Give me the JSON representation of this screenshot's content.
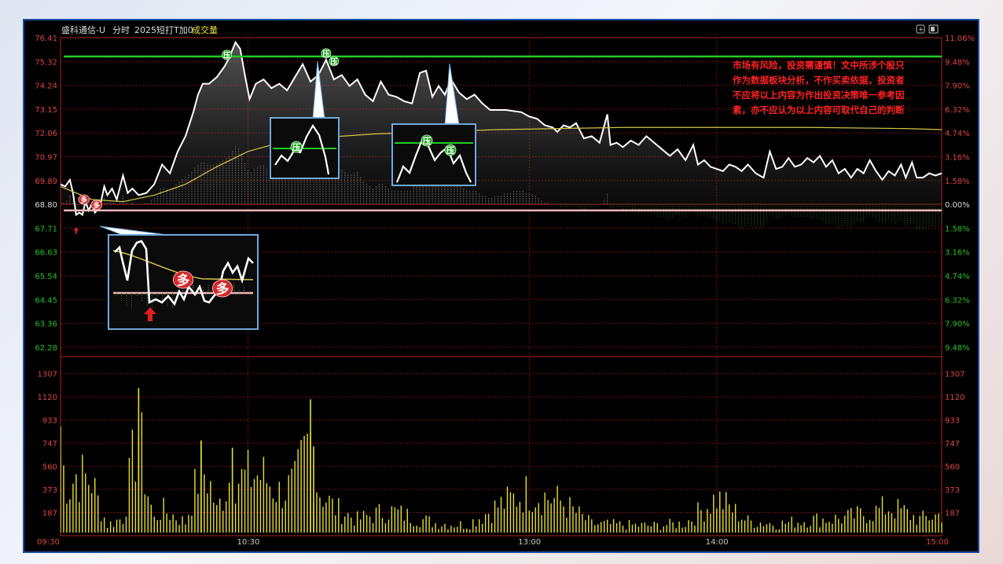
{
  "header": {
    "stock_name": "盛科通信-U",
    "view": "分时",
    "indicator": "2025短打T加0",
    "volume_label": "成交量"
  },
  "warning": [
    "市场有风险，投资需谨慎！文中所涉个股只",
    "作为数据板块分析，不作买卖依据，投资者",
    "不应将以上内容为作出投资决策唯一参考因",
    "素，亦不应认为以上内容可取代自己的判断"
  ],
  "signals": {
    "buy_char": "多",
    "resist_char": "压"
  },
  "colors": {
    "price_line": "#ffffff",
    "avg_line": "#d4c84a",
    "resistance": "#22cc22",
    "support": "#f0b6b6",
    "up_text": "#e04444",
    "down_text": "#28c028",
    "volume_bar": "#e8e030",
    "grid": "#7a0e0e",
    "border": "#1d4fa8"
  },
  "chart_data": {
    "type": "line",
    "price_axis": {
      "ticks": [
        "76.41",
        "75.32",
        "74.24",
        "73.15",
        "72.06",
        "70.97",
        "69.89",
        "68.80",
        "67.71",
        "66.63",
        "65.54",
        "64.45",
        "63.36",
        "62.28"
      ],
      "pct_ticks": [
        "11.06%",
        "9.48%",
        "7.90%",
        "6.32%",
        "4.74%",
        "3.16%",
        "1.58%",
        "0.00%",
        "1.58%",
        "3.16%",
        "4.74%",
        "6.32%",
        "7.90%",
        "9.48%"
      ],
      "reference_price": 68.8,
      "ylim": [
        62.28,
        76.41
      ]
    },
    "volume_axis": {
      "ticks": [
        "1307",
        "1120",
        "933",
        "747",
        "560",
        "373",
        "187"
      ],
      "ylim": [
        0,
        1400
      ]
    },
    "time_labels": [
      "09:30",
      "10:30",
      "13:00",
      "14:00",
      "15:00"
    ],
    "resistance_level": 75.55,
    "support_level": 68.5,
    "price_series": [
      {
        "t": 0,
        "v": 69.7
      },
      {
        "t": 3,
        "v": 69.6
      },
      {
        "t": 6,
        "v": 69.9
      },
      {
        "t": 8,
        "v": 69.3
      },
      {
        "t": 10,
        "v": 68.3
      },
      {
        "t": 12,
        "v": 68.4
      },
      {
        "t": 14,
        "v": 68.3
      },
      {
        "t": 16,
        "v": 68.9
      },
      {
        "t": 18,
        "v": 68.5
      },
      {
        "t": 20,
        "v": 68.8
      },
      {
        "t": 22,
        "v": 68.4
      },
      {
        "t": 25,
        "v": 68.6
      },
      {
        "t": 28,
        "v": 69.6
      },
      {
        "t": 30,
        "v": 69.2
      },
      {
        "t": 33,
        "v": 69.5
      },
      {
        "t": 36,
        "v": 69.0
      },
      {
        "t": 40,
        "v": 70.1
      },
      {
        "t": 43,
        "v": 69.3
      },
      {
        "t": 46,
        "v": 69.5
      },
      {
        "t": 50,
        "v": 69.2
      },
      {
        "t": 55,
        "v": 69.3
      },
      {
        "t": 60,
        "v": 69.7
      },
      {
        "t": 65,
        "v": 70.6
      },
      {
        "t": 70,
        "v": 70.2
      },
      {
        "t": 75,
        "v": 71.2
      },
      {
        "t": 80,
        "v": 71.9
      },
      {
        "t": 85,
        "v": 73.0
      },
      {
        "t": 88,
        "v": 73.8
      },
      {
        "t": 91,
        "v": 74.3
      },
      {
        "t": 95,
        "v": 74.3
      },
      {
        "t": 100,
        "v": 74.6
      },
      {
        "t": 105,
        "v": 75.1
      },
      {
        "t": 108,
        "v": 75.5
      },
      {
        "t": 112,
        "v": 76.2
      },
      {
        "t": 115,
        "v": 75.9
      },
      {
        "t": 118,
        "v": 74.7
      },
      {
        "t": 121,
        "v": 73.6
      },
      {
        "t": 125,
        "v": 74.3
      },
      {
        "t": 130,
        "v": 74.5
      },
      {
        "t": 135,
        "v": 74.1
      },
      {
        "t": 140,
        "v": 74.3
      },
      {
        "t": 145,
        "v": 74.0
      },
      {
        "t": 150,
        "v": 74.6
      },
      {
        "t": 155,
        "v": 75.2
      },
      {
        "t": 160,
        "v": 74.4
      },
      {
        "t": 165,
        "v": 74.7
      },
      {
        "t": 170,
        "v": 75.4
      },
      {
        "t": 175,
        "v": 74.5
      },
      {
        "t": 180,
        "v": 74.7
      },
      {
        "t": 185,
        "v": 74.2
      },
      {
        "t": 190,
        "v": 74.5
      },
      {
        "t": 195,
        "v": 73.8
      },
      {
        "t": 200,
        "v": 73.5
      },
      {
        "t": 205,
        "v": 74.4
      },
      {
        "t": 210,
        "v": 73.8
      },
      {
        "t": 215,
        "v": 73.7
      },
      {
        "t": 220,
        "v": 73.5
      },
      {
        "t": 225,
        "v": 73.4
      },
      {
        "t": 230,
        "v": 74.8
      },
      {
        "t": 234,
        "v": 74.9
      },
      {
        "t": 238,
        "v": 73.7
      },
      {
        "t": 242,
        "v": 74.2
      },
      {
        "t": 246,
        "v": 73.8
      },
      {
        "t": 250,
        "v": 74.5
      },
      {
        "t": 255,
        "v": 73.9
      },
      {
        "t": 260,
        "v": 73.6
      },
      {
        "t": 265,
        "v": 73.8
      },
      {
        "t": 270,
        "v": 73.4
      },
      {
        "t": 275,
        "v": 73.1
      },
      {
        "t": 285,
        "v": 73.1
      },
      {
        "t": 295,
        "v": 73.0
      },
      {
        "t": 300,
        "v": 72.8
      },
      {
        "t": 305,
        "v": 72.7
      },
      {
        "t": 310,
        "v": 72.4
      },
      {
        "t": 315,
        "v": 72.3
      },
      {
        "t": 318,
        "v": 72.1
      },
      {
        "t": 322,
        "v": 72.4
      },
      {
        "t": 326,
        "v": 72.3
      },
      {
        "t": 330,
        "v": 72.5
      },
      {
        "t": 335,
        "v": 71.8
      },
      {
        "t": 340,
        "v": 71.9
      },
      {
        "t": 345,
        "v": 71.6
      },
      {
        "t": 350,
        "v": 72.9
      },
      {
        "t": 352,
        "v": 71.5
      },
      {
        "t": 356,
        "v": 71.6
      },
      {
        "t": 360,
        "v": 71.4
      },
      {
        "t": 365,
        "v": 71.7
      },
      {
        "t": 370,
        "v": 71.5
      },
      {
        "t": 375,
        "v": 71.9
      },
      {
        "t": 380,
        "v": 71.6
      },
      {
        "t": 385,
        "v": 71.3
      },
      {
        "t": 390,
        "v": 71.0
      },
      {
        "t": 395,
        "v": 71.3
      },
      {
        "t": 400,
        "v": 70.8
      },
      {
        "t": 405,
        "v": 71.5
      },
      {
        "t": 408,
        "v": 70.6
      },
      {
        "t": 412,
        "v": 70.8
      },
      {
        "t": 416,
        "v": 70.5
      },
      {
        "t": 420,
        "v": 70.4
      },
      {
        "t": 424,
        "v": 70.3
      },
      {
        "t": 428,
        "v": 70.6
      },
      {
        "t": 432,
        "v": 70.5
      },
      {
        "t": 436,
        "v": 70.3
      },
      {
        "t": 440,
        "v": 70.6
      },
      {
        "t": 445,
        "v": 70.2
      },
      {
        "t": 450,
        "v": 70.0
      },
      {
        "t": 454,
        "v": 71.2
      },
      {
        "t": 458,
        "v": 70.4
      },
      {
        "t": 462,
        "v": 70.5
      },
      {
        "t": 466,
        "v": 70.9
      },
      {
        "t": 470,
        "v": 70.5
      },
      {
        "t": 474,
        "v": 70.6
      },
      {
        "t": 478,
        "v": 70.9
      },
      {
        "t": 482,
        "v": 70.7
      },
      {
        "t": 486,
        "v": 71.0
      },
      {
        "t": 490,
        "v": 70.5
      },
      {
        "t": 494,
        "v": 70.8
      },
      {
        "t": 498,
        "v": 70.2
      },
      {
        "t": 502,
        "v": 70.4
      },
      {
        "t": 506,
        "v": 70.0
      },
      {
        "t": 510,
        "v": 70.4
      },
      {
        "t": 514,
        "v": 70.2
      },
      {
        "t": 518,
        "v": 70.8
      },
      {
        "t": 522,
        "v": 70.3
      },
      {
        "t": 526,
        "v": 69.9
      },
      {
        "t": 530,
        "v": 70.3
      },
      {
        "t": 534,
        "v": 70.1
      },
      {
        "t": 538,
        "v": 70.6
      },
      {
        "t": 541,
        "v": 70.0
      },
      {
        "t": 545,
        "v": 70.7
      },
      {
        "t": 548,
        "v": 70.0
      },
      {
        "t": 552,
        "v": 70.0
      },
      {
        "t": 556,
        "v": 70.2
      },
      {
        "t": 560,
        "v": 70.1
      },
      {
        "t": 564,
        "v": 70.2
      }
    ],
    "avg_series": [
      {
        "t": 0,
        "v": 69.6
      },
      {
        "t": 20,
        "v": 69.0
      },
      {
        "t": 40,
        "v": 68.9
      },
      {
        "t": 60,
        "v": 69.2
      },
      {
        "t": 80,
        "v": 69.7
      },
      {
        "t": 100,
        "v": 70.5
      },
      {
        "t": 120,
        "v": 71.2
      },
      {
        "t": 140,
        "v": 71.6
      },
      {
        "t": 160,
        "v": 71.8
      },
      {
        "t": 200,
        "v": 72.0
      },
      {
        "t": 240,
        "v": 72.1
      },
      {
        "t": 280,
        "v": 72.2
      },
      {
        "t": 320,
        "v": 72.25
      },
      {
        "t": 360,
        "v": 72.3
      },
      {
        "t": 420,
        "v": 72.3
      },
      {
        "t": 480,
        "v": 72.3
      },
      {
        "t": 540,
        "v": 72.25
      },
      {
        "t": 564,
        "v": 72.2
      }
    ],
    "volume_keypoints": [
      {
        "t": 0,
        "v": 880
      },
      {
        "t": 5,
        "v": 520
      },
      {
        "t": 10,
        "v": 680
      },
      {
        "t": 15,
        "v": 640
      },
      {
        "t": 20,
        "v": 610
      },
      {
        "t": 25,
        "v": 330
      },
      {
        "t": 30,
        "v": 120
      },
      {
        "t": 40,
        "v": 200
      },
      {
        "t": 50,
        "v": 1190
      },
      {
        "t": 55,
        "v": 550
      },
      {
        "t": 60,
        "v": 180
      },
      {
        "t": 65,
        "v": 290
      },
      {
        "t": 80,
        "v": 150
      },
      {
        "t": 90,
        "v": 760
      },
      {
        "t": 95,
        "v": 620
      },
      {
        "t": 100,
        "v": 270
      },
      {
        "t": 110,
        "v": 710
      },
      {
        "t": 115,
        "v": 620
      },
      {
        "t": 125,
        "v": 680
      },
      {
        "t": 130,
        "v": 650
      },
      {
        "t": 140,
        "v": 480
      },
      {
        "t": 150,
        "v": 560
      },
      {
        "t": 160,
        "v": 1100
      },
      {
        "t": 162,
        "v": 720
      },
      {
        "t": 165,
        "v": 520
      },
      {
        "t": 175,
        "v": 310
      },
      {
        "t": 190,
        "v": 180
      },
      {
        "t": 210,
        "v": 280
      },
      {
        "t": 240,
        "v": 140
      },
      {
        "t": 260,
        "v": 120
      },
      {
        "t": 280,
        "v": 330
      },
      {
        "t": 300,
        "v": 490
      },
      {
        "t": 320,
        "v": 380
      },
      {
        "t": 340,
        "v": 130
      },
      {
        "t": 360,
        "v": 120
      },
      {
        "t": 380,
        "v": 110
      },
      {
        "t": 400,
        "v": 140
      },
      {
        "t": 420,
        "v": 420
      },
      {
        "t": 440,
        "v": 160
      },
      {
        "t": 460,
        "v": 130
      },
      {
        "t": 480,
        "v": 180
      },
      {
        "t": 500,
        "v": 190
      },
      {
        "t": 520,
        "v": 260
      },
      {
        "t": 530,
        "v": 320
      },
      {
        "t": 540,
        "v": 260
      },
      {
        "t": 550,
        "v": 180
      },
      {
        "t": 564,
        "v": 240
      }
    ]
  }
}
